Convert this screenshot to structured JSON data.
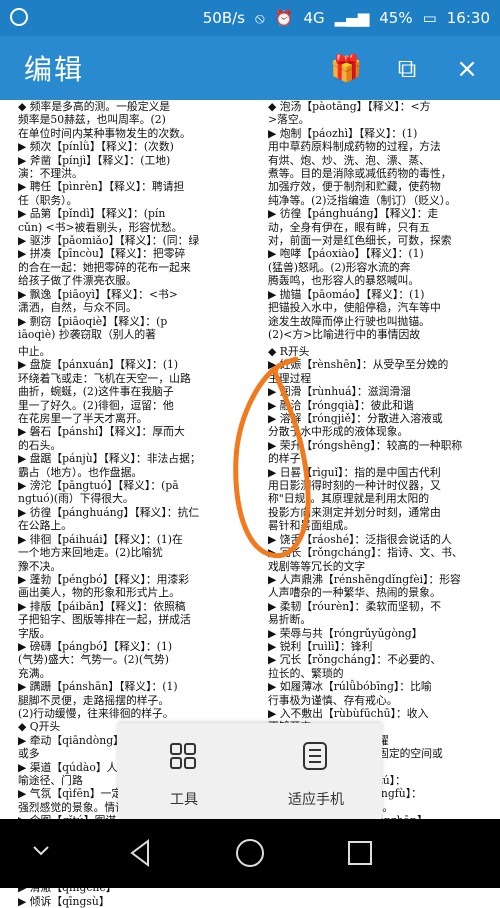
{
  "status_bar": {
    "left_icon": "circle-icon",
    "speed": "50B/s",
    "signal": "4G",
    "network_small": "4G",
    "battery": "45%",
    "time": "16:30"
  },
  "app_bar": {
    "title": "编辑",
    "icons": [
      "gift-icon",
      "copy-icon",
      "close-icon"
    ]
  },
  "document": {
    "page1_left": "◆ 频率是多高的测。一般定义是\n频率是50赫兹，也叫周率。(2)\n在单位时间内某种事物发生的次数。\n▶ 频次【pínlǜ】【释义】：(次数)\n▶ 斧凿【pínjì】【释义】：(工地)\n演：不理洪。\n▶ 聘任【pìnrèn】【释义】：聘请担\n任（职务）。\n▶ 品第【pǐndì】【释义】：(pín\ncǔn) <书>被看剔头，形容忧愁。\n▶ 驱涉【pǎomiǎo】【释义】：(同：绿\n▶ 拼凑【pīncòu】【释义】：把零碎\n的合在一起：她把零碎的花布一起来\n给孩子做了件漂亮衣服。\n▶ 飘逸【piāoyì】【释义】：<书>\n潇洒，自然，与众不同。\n▶ 剽窃【piāoqiè】【释义】：(p\niāoqiè) 抄袭窃取（别人的著",
    "page1_right": "◆ 泡汤【pàotāng】【释义】：<方\n>落空。\n▶ 炮制【páozhì】【释义】：(1)\n用中草药原料制成药物的过程，方法\n有烘、炮、炒、洗、泡、漂、蒸、\n煮等。目的是消除或减低药物的毒性，\n加强疗效，便于制剂和贮藏，使药物\n纯净等。(2)泛指编造（制订）（贬义）。\n▶ 彷徨【pánghuáng】【释义】：走\n动，全身有伊在，眼有眸，只有五\n对，前面一对是红色细长，可数，探索\n▶ 咆哮【páoxiào】【释义】：(1)\n(猛兽)怒吼。(2)形容水流的奔\n腾轰鸣，也形容人的暴怒喊叫。\n▶ 抛锚【pāomáo】【释义】：(1)\n把锚投入水中，使船停稳，汽车等中\n途发生故障而停止行驶也叫抛锚。\n(2)<方>比喻进行中的事情因故",
    "page2_left": "中止。\n▶ 盘旋【pánxuán】【释义】：(1)\n环绕着飞或走：飞机在天空一，山路\n曲折，蜿蜒，(2)这件事在我脑子\n里一了好久。(2)徘徊，逗留：他\n在花房里一了半天才离开。\n▶ 磐石【pánshí】【释义】：厚而大\n的石头。\n▶ 盘踞【pánjù】【释义】：非法占据；\n霸占（地方）。也作盘据。\n▶ 滂沱【pāngtuó】【释义】：(pā\nngtuó)(雨）下得很大。\n▶ 彷徨【pánghuáng】【释义】：抗仁\n在公路上。\n▶ 徘徊【páihuái】【释义】：(1)在\n一个地方来回地走。(2)比喻犹\n豫不决。\n▶ 蓬勃【péngbó】【释义】：用漆彩\n画出美人，物的形象和形式片上。\n▶ 排版【páibǎn】【释义】：依照稿\n子把铅字、图版等排在一起，拼成活\n字版。\n▶ 磅礴【pángbó】【释义】：(1)\n(气势)盛大：气势一。(2)(气势)\n充满。\n▶ 蹒跚【pánshān】【释义】：(1)\n腿脚不灵便，走路摇摆的样子。\n(2)行动缓慢，往来徘徊的样子。\n◆ Q开头\n▶ 牵动【qiāndòng】因动力推动、带动，\n或多\n▶ 渠道【qúdào】人工开凿的水道，比\n喻途径、门路\n▶ 气氛【qìfēn】一定环境中给人某种\n强烈感觉的景象。情调等\n▶ 企图【qǐtú】图谋，指称某人的神灵\n数的自己的愿望。称或者对错神符号\n▶ 抢先【qiǎng】抢在别人前面，\n▶ 恰谈【qiàtán】\n▶ 青睐【qīnglài】\n▶ 清澈【qīngchè】\n▶ 倾诉【qīngsù】",
    "page2_right": "◆ R开头\n▶ 妊娠【rènshēn】：从受孕至分娩的\n生理过程\n▶ 润滑【rùnhuá】：滋润滑溜\n▶ 融洽【róngqià】：彼此和谐\n▶ 溶解【róngjiě】：分散进入溶液或\n分散于水中形成的液体现象。\n▶ 荣升【róngshēng】：较高的一种职称\n的样子\n▶ 日晷【rìguǐ】：指的是中国古代利\n用日影测得时刻的一种计时仪器，又\n称\"日规\"。其原理就是利用太阳的\n投影方向来测定并划分时刻，通常由\n晷针和晷面组成。\n▶ 饶舌【ráoshé】：泛指很会说话的人\n▶ 冗长【rǒngcháng】：指诗、文、书、\n戏剧等等冗长的文字\n▶ 人声鼎沸【rénshēngdǐngfèi】：形容\n人声嘈杂的一种繁华、热闹的景象。\n▶ 柔韧【róurèn】：柔软而坚韧，不\n易折断。\n▶ 荣辱与共【róngrǔyǔgòng】\n▶ 锐利【ruìlì】：锋利\n▶ 冗长【rǒngcháng】：不必要的、\n拉长的、繁琐的\n▶ 如履薄冰【rúlǚbóbīng】：比喻\n行事极为谨慎、存有戒心。\n▶ 入不敷出【rùbùfūchū】：收入\n不够开支。\n▶ 荣誉【róngyù】：荣耀\n▶ 容纳【róngnà】：在固定的空间或\n范围内接受（人或事物）\n▶ 如火如荼【rúhuǒrútú】：\n▶ 如释重负【rúshìzhòngfù】：\n▶ 蹂躏【róulìn】：践踏。\n▶ 如坐针毡【rúzuòzhēnzhān】\n▶ 睿智【ruìzhì】：聪慧；英明而有远见"
  },
  "toolbar": {
    "tools_label": "工具",
    "fit_label": "适应手机"
  },
  "nav": {
    "icons": [
      "collapse-icon",
      "back-icon",
      "home-icon",
      "recent-apps-icon"
    ]
  }
}
